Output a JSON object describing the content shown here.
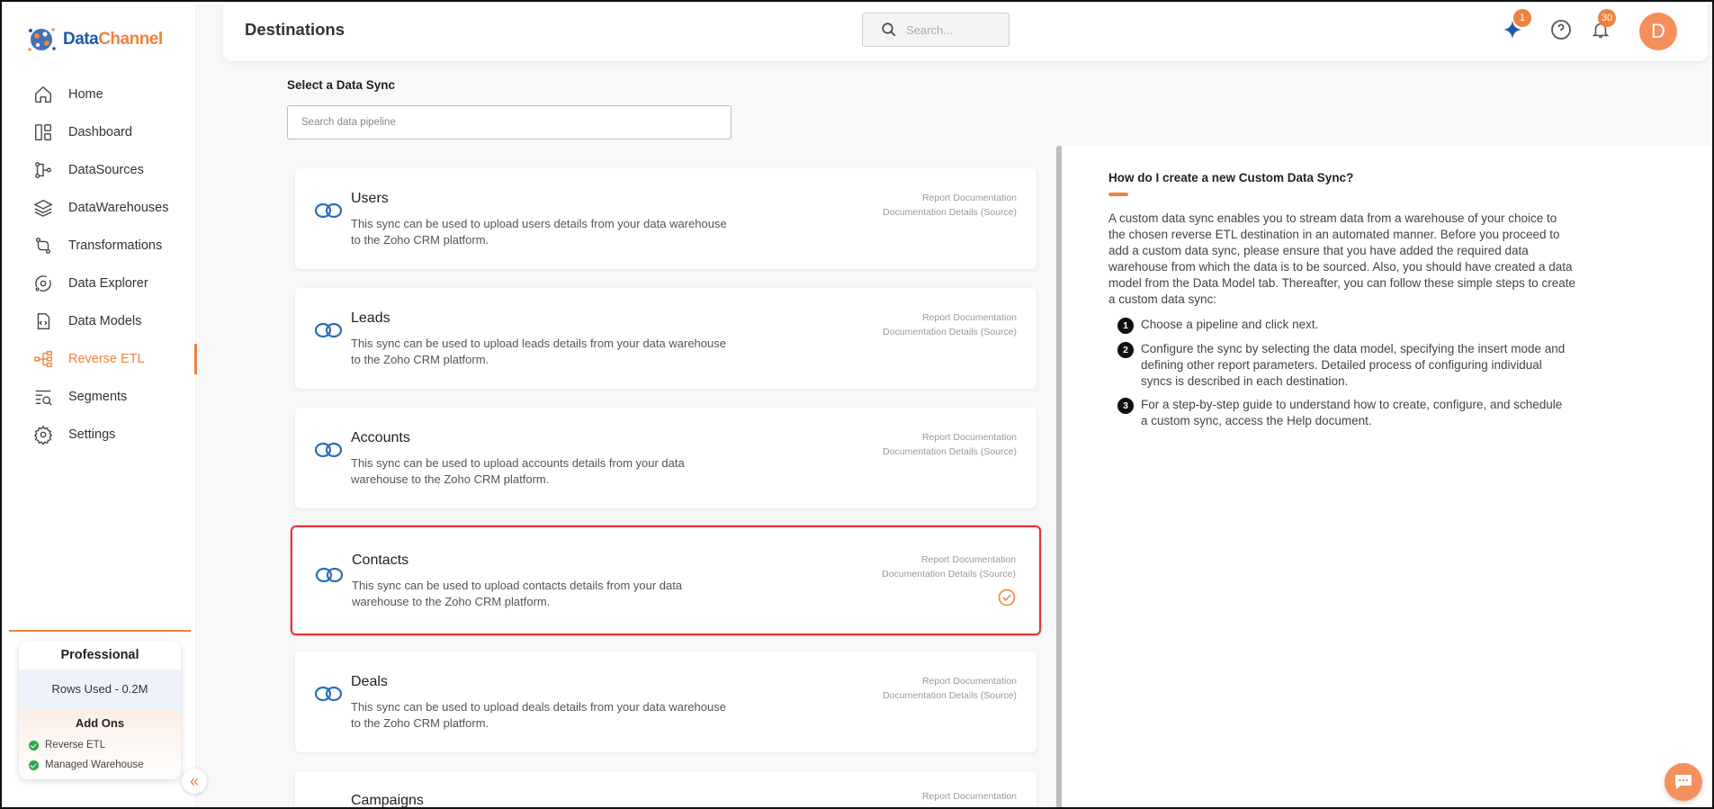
{
  "app": {
    "brand_primary": "Data",
    "brand_secondary": "Channel",
    "accent": "#f0823f"
  },
  "sidebar": {
    "items": [
      {
        "label": "Home",
        "icon": "home-icon"
      },
      {
        "label": "Dashboard",
        "icon": "dashboard-icon"
      },
      {
        "label": "DataSources",
        "icon": "datasources-icon"
      },
      {
        "label": "DataWarehouses",
        "icon": "layers-icon"
      },
      {
        "label": "Transformations",
        "icon": "transformations-icon"
      },
      {
        "label": "Data Explorer",
        "icon": "explorer-icon"
      },
      {
        "label": "Data Models",
        "icon": "data-models-icon"
      },
      {
        "label": "Reverse ETL",
        "icon": "reverse-etl-icon",
        "active": true
      },
      {
        "label": "Segments",
        "icon": "segments-icon"
      },
      {
        "label": "Settings",
        "icon": "gear-icon"
      }
    ],
    "plan": {
      "name": "Professional",
      "rows_used": "Rows Used - 0.2M",
      "addons_title": "Add Ons",
      "addons": [
        "Reverse ETL",
        "Managed Warehouse"
      ]
    }
  },
  "header": {
    "title": "Destinations",
    "search_placeholder": "Search...",
    "sparkle_badge": "1",
    "notifications_badge": "30",
    "avatar_initial": "D"
  },
  "main": {
    "select_label": "Select a Data Sync",
    "pipeline_search_placeholder": "Search data pipeline",
    "doc_link_1": "Report Documentation",
    "doc_link_2": "Documentation Details (Source)",
    "syncs": [
      {
        "title": "Users",
        "desc": "This sync can be used to upload users details from your data warehouse to the Zoho CRM platform.",
        "selected": false
      },
      {
        "title": "Leads",
        "desc": "This sync can be used to upload leads details from your data warehouse to the Zoho CRM platform.",
        "selected": false
      },
      {
        "title": "Accounts",
        "desc": "This sync can be used to upload accounts details from your data warehouse to the Zoho CRM platform.",
        "selected": false
      },
      {
        "title": "Contacts",
        "desc": "This sync can be used to upload contacts details from your data warehouse to the Zoho CRM platform.",
        "selected": true
      },
      {
        "title": "Deals",
        "desc": "This sync can be used to upload deals details from your data warehouse to the Zoho CRM platform.",
        "selected": false
      },
      {
        "title": "Campaigns",
        "desc": "",
        "selected": false
      }
    ]
  },
  "help": {
    "title": "How do I create a new Custom Data Sync?",
    "body": "A custom data sync enables you to stream data from a warehouse of your choice to the chosen reverse ETL destination in an automated manner. Before you proceed to add a custom data sync, please ensure that you have added the required data warehouse from which the data is to be sourced. Also, you should have created a data model from the Data Model tab. Thereafter, you can follow these simple steps to create a custom data sync:",
    "steps": [
      {
        "num": "1",
        "text": "Choose a pipeline and click next."
      },
      {
        "num": "2",
        "text": "Configure the sync by selecting the data model, specifying the insert mode and defining other report parameters. Detailed process of configuring individual syncs is described in each destination."
      },
      {
        "num": "3",
        "text": "For a step-by-step guide to understand how to create, configure, and schedule a custom sync, access the Help document."
      }
    ]
  }
}
